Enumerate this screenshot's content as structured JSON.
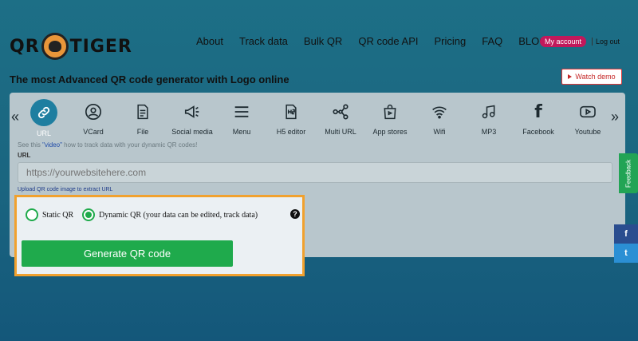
{
  "header": {
    "logo_left": "QR",
    "logo_right": "TIGER",
    "nav": [
      "About",
      "Track data",
      "Bulk QR",
      "QR code API",
      "Pricing",
      "FAQ",
      "BLOG"
    ],
    "my_account": "My account",
    "logout": "Log out",
    "tagline": "The most Advanced QR code generator with Logo online",
    "watch_demo": "Watch demo"
  },
  "types": [
    {
      "label": "URL",
      "icon": "link-icon",
      "active": true
    },
    {
      "label": "VCard",
      "icon": "contact-icon"
    },
    {
      "label": "File",
      "icon": "file-icon"
    },
    {
      "label": "Social media",
      "icon": "megaphone-icon"
    },
    {
      "label": "Menu",
      "icon": "menu-icon"
    },
    {
      "label": "H5 editor",
      "icon": "h5-icon"
    },
    {
      "label": "Multi URL",
      "icon": "network-icon"
    },
    {
      "label": "App stores",
      "icon": "shopping-bag-icon"
    },
    {
      "label": "Wifi",
      "icon": "wifi-icon"
    },
    {
      "label": "MP3",
      "icon": "music-icon"
    },
    {
      "label": "Facebook",
      "icon": "facebook-icon"
    },
    {
      "label": "Youtube",
      "icon": "youtube-icon"
    }
  ],
  "form": {
    "hint_pre": "See this ",
    "hint_link": "\"video\"",
    "hint_post": " how to track data with your dynamic QR codes!",
    "url_label": "URL",
    "url_placeholder": "https://yourwebsitehere.com",
    "upload_link": "Upload QR code image to extract URL"
  },
  "options": {
    "static": "Static QR",
    "dynamic": "Dynamic QR (your data can be edited, track data)",
    "selected": "dynamic",
    "help": "?"
  },
  "generate_label": "Generate QR code",
  "side": {
    "feedback": "Feedback",
    "facebook": "f",
    "twitter": "t"
  },
  "colors": {
    "accent": "#1faa4c",
    "highlight": "#f1a12e",
    "active_icon": "#1e7ea0",
    "account": "#c2185b"
  }
}
